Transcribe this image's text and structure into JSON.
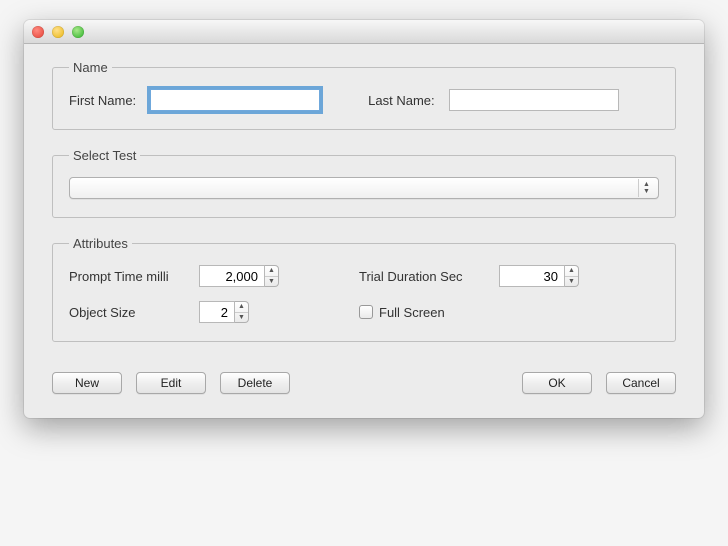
{
  "name_group": {
    "legend": "Name",
    "first_label": "First Name:",
    "first_value": "",
    "last_label": "Last Name:",
    "last_value": ""
  },
  "select_test_group": {
    "legend": "Select Test",
    "selected": ""
  },
  "attributes_group": {
    "legend": "Attributes",
    "prompt_label": "Prompt Time milli",
    "prompt_value": "2,000",
    "trial_label": "Trial Duration Sec",
    "trial_value": "30",
    "objsize_label": "Object Size",
    "objsize_value": "2",
    "fullscreen_label": "Full Screen",
    "fullscreen_checked": false
  },
  "buttons": {
    "new": "New",
    "edit": "Edit",
    "delete": "Delete",
    "ok": "OK",
    "cancel": "Cancel"
  }
}
